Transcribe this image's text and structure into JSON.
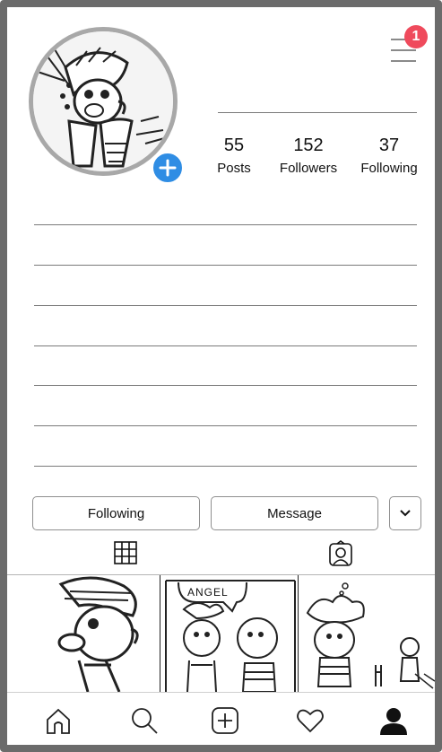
{
  "profile": {
    "notification_count": "1",
    "stats": [
      {
        "value": "55",
        "label": "Posts"
      },
      {
        "value": "152",
        "label": "Followers"
      },
      {
        "value": "37",
        "label": "Following"
      }
    ]
  },
  "actions": {
    "following_label": "Following",
    "message_label": "Message"
  },
  "posts": {
    "caption_text": "ANGEL"
  },
  "icons": {
    "menu": "hamburger-icon",
    "add": "plus-icon",
    "dropdown": "chevron-down-icon",
    "grid_tab": "grid-icon",
    "tagged_tab": "tagged-person-icon",
    "nav": [
      "home-icon",
      "search-icon",
      "add-post-icon",
      "heart-icon",
      "profile-icon"
    ]
  },
  "colors": {
    "accent_blue": "#2f8de4",
    "badge_red": "#ef4a5c",
    "frame_gray": "#6b6b6b"
  }
}
